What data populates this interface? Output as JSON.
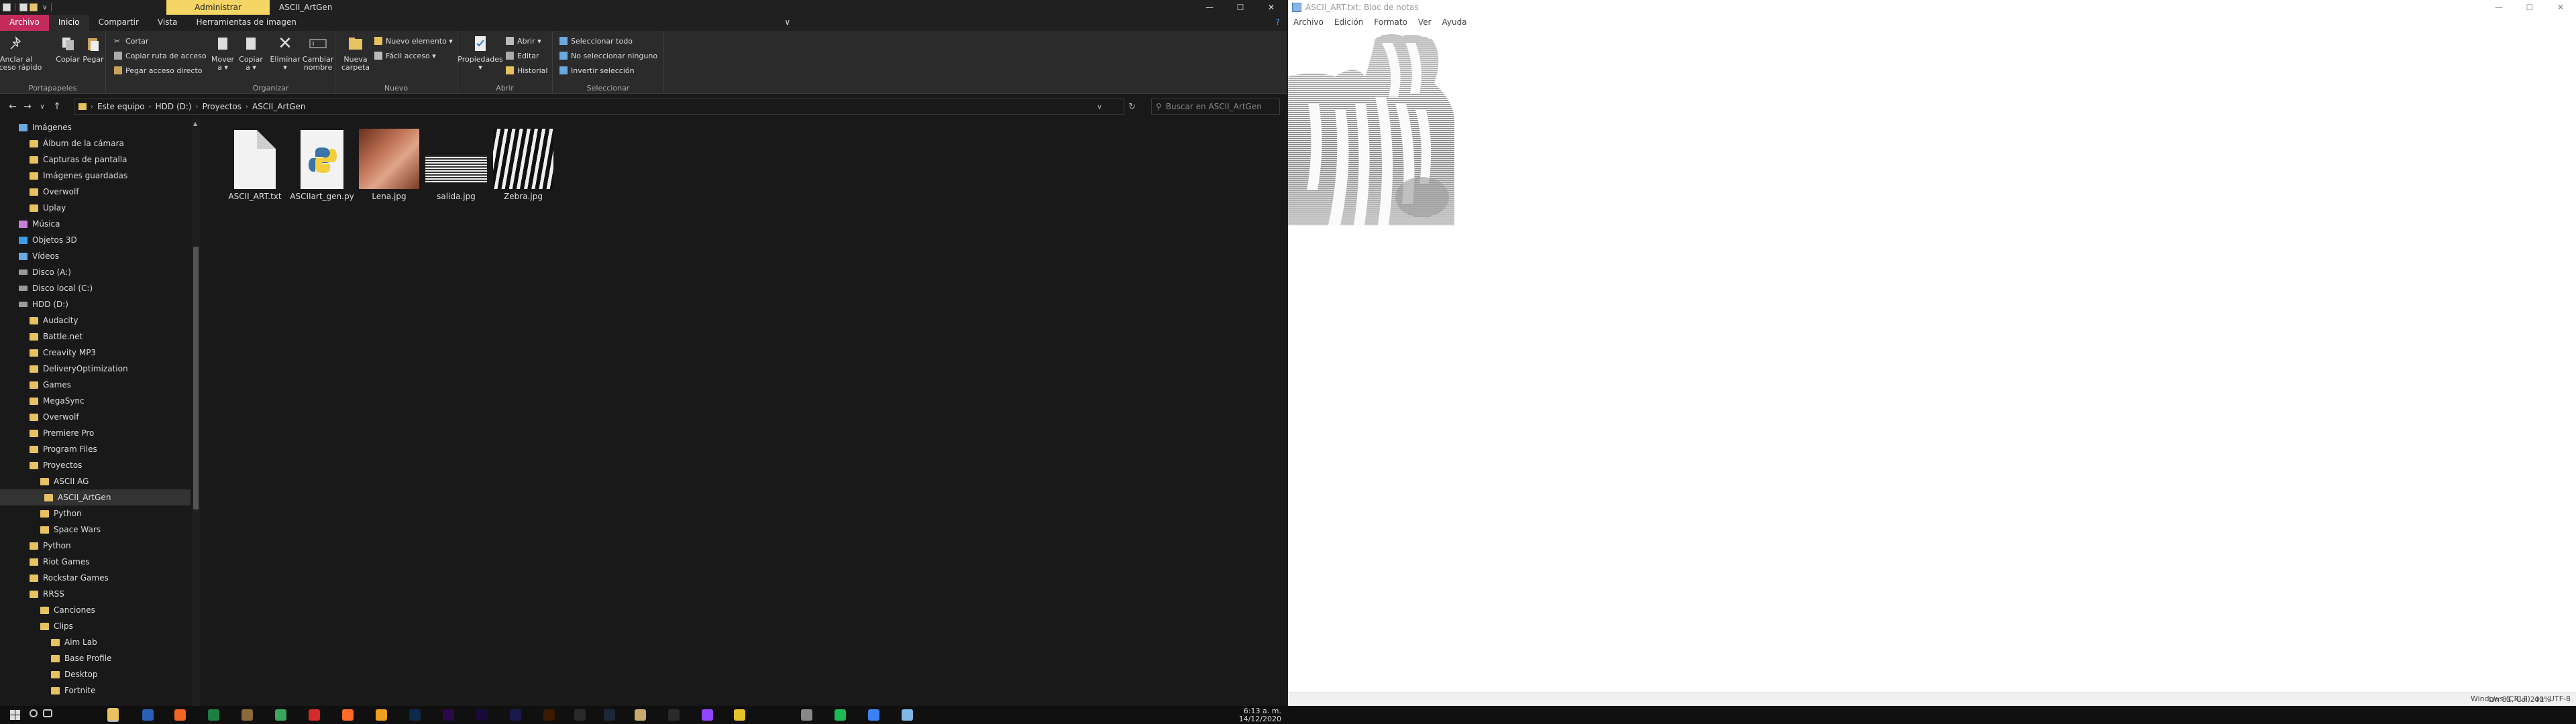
{
  "explorer": {
    "title": "ASCII_ArtGen",
    "context_tab": "Administrar",
    "window_controls": [
      "—",
      "☐",
      "✕"
    ],
    "ribbon_tabs": [
      {
        "label": "Archivo"
      },
      {
        "label": "Inicio"
      },
      {
        "label": "Compartir"
      },
      {
        "label": "Vista"
      },
      {
        "label": "Herramientas de imagen"
      }
    ],
    "ribbon": {
      "portapapeles": {
        "label": "Portapapeles",
        "anclar": "Anclar al\nacceso rápido",
        "copiar": "Copiar",
        "pegar": "Pegar",
        "cortar": "Cortar",
        "copiar_ruta": "Copiar ruta de acceso",
        "pegar_acceso": "Pegar acceso directo"
      },
      "organizar": {
        "label": "Organizar",
        "mover": "Mover\na ▾",
        "copiar": "Copiar\na ▾",
        "eliminar": "Eliminar\n▾",
        "cambiar": "Cambiar\nnombre"
      },
      "nuevo": {
        "label": "Nuevo",
        "nueva_carpeta": "Nueva\ncarpeta",
        "nuevo_elemento": "Nuevo elemento ▾",
        "facil_acceso": "Fácil acceso ▾"
      },
      "abrir": {
        "label": "Abrir",
        "propiedades": "Propiedades\n▾",
        "abrir": "Abrir ▾",
        "editar": "Editar",
        "historial": "Historial"
      },
      "seleccionar": {
        "label": "Seleccionar",
        "todo": "Seleccionar todo",
        "ninguno": "No seleccionar ninguno",
        "invertir": "Invertir selección"
      }
    },
    "breadcrumb": [
      "Este equipo",
      "HDD (D:)",
      "Proyectos",
      "ASCII_ArtGen"
    ],
    "search_placeholder": "Buscar en ASCII_ArtGen",
    "nav_items": [
      {
        "label": "Imágenes",
        "indent": 0
      },
      {
        "label": "Álbum de la cámara",
        "indent": 1
      },
      {
        "label": "Capturas de pantalla",
        "indent": 1
      },
      {
        "label": "Imágenes guardadas",
        "indent": 1
      },
      {
        "label": "Overwolf",
        "indent": 1
      },
      {
        "label": "Uplay",
        "indent": 1
      },
      {
        "label": "Música",
        "indent": 0
      },
      {
        "label": "Objetos 3D",
        "indent": 0
      },
      {
        "label": "Vídeos",
        "indent": 0
      },
      {
        "label": "Disco (A:)",
        "indent": 0
      },
      {
        "label": "Disco local (C:)",
        "indent": 0
      },
      {
        "label": "HDD (D:)",
        "indent": 0
      },
      {
        "label": "Audacity",
        "indent": 1
      },
      {
        "label": "Battle.net",
        "indent": 1
      },
      {
        "label": "Creavity MP3",
        "indent": 1
      },
      {
        "label": "DeliveryOptimization",
        "indent": 1
      },
      {
        "label": "Games",
        "indent": 1
      },
      {
        "label": "MegaSync",
        "indent": 1
      },
      {
        "label": "Overwolf",
        "indent": 1
      },
      {
        "label": "Premiere Pro",
        "indent": 1
      },
      {
        "label": "Program Files",
        "indent": 1
      },
      {
        "label": "Proyectos",
        "indent": 1
      },
      {
        "label": "ASCII AG",
        "indent": 2
      },
      {
        "label": "ASCII_ArtGen",
        "indent": 2
      },
      {
        "label": "Python",
        "indent": 2
      },
      {
        "label": "Space Wars",
        "indent": 2
      },
      {
        "label": "Python",
        "indent": 1
      },
      {
        "label": "Riot Games",
        "indent": 1
      },
      {
        "label": "Rockstar Games",
        "indent": 1
      },
      {
        "label": "RRSS",
        "indent": 1
      },
      {
        "label": "Canciones",
        "indent": 2
      },
      {
        "label": "Clips",
        "indent": 2
      },
      {
        "label": "Aim Lab",
        "indent": 3
      },
      {
        "label": "Base Profile",
        "indent": 3
      },
      {
        "label": "Desktop",
        "indent": 3
      },
      {
        "label": "Fortnite",
        "indent": 3
      }
    ],
    "files": [
      {
        "name": "ASCII_ART.txt",
        "kind": "txt"
      },
      {
        "name": "ASCIIart_gen.py",
        "kind": "py"
      },
      {
        "name": "Lena.jpg",
        "kind": "lena"
      },
      {
        "name": "salida.jpg",
        "kind": "salida"
      },
      {
        "name": "Zebra.jpg",
        "kind": "zebra"
      }
    ]
  },
  "notepad": {
    "title": "ASCII_ART.txt: Bloc de notas",
    "menu": [
      "Archivo",
      "Edición",
      "Formato",
      "Ver",
      "Ayuda"
    ],
    "status": {
      "position": "Lín 81, Col 201",
      "zoom": "40%",
      "eol": "Windows (CRLF)",
      "encoding": "UTF-8"
    }
  },
  "taskbar": {
    "time": "6:13 a. m.",
    "date": "14/12/2020",
    "apps": [
      {
        "name": "windows-start-icon",
        "color": "#4da3ff"
      },
      {
        "name": "search-icon",
        "color": "#cccccc"
      },
      {
        "name": "task-view-icon",
        "color": "#cccccc"
      },
      {
        "name": "file-explorer-icon",
        "color": "#e8c25f",
        "active": true
      },
      {
        "name": "word-icon",
        "color": "#2b5fb5"
      },
      {
        "name": "origin-icon",
        "color": "#f26522"
      },
      {
        "name": "excel-icon",
        "color": "#1e7f45"
      },
      {
        "name": "minecraft-icon",
        "color": "#8a6a3a"
      },
      {
        "name": "chrome-icon",
        "color": "#3ba55d"
      },
      {
        "name": "opera-icon",
        "color": "#d42a2a"
      },
      {
        "name": "brave-icon",
        "color": "#ff6a2b"
      },
      {
        "name": "audacity-icon",
        "color": "#f0a020"
      },
      {
        "name": "photoshop-icon",
        "color": "#0c2a4a"
      },
      {
        "name": "premiere-icon",
        "color": "#2a0a4a"
      },
      {
        "name": "after-effects-icon",
        "color": "#1a0a3a"
      },
      {
        "name": "adobe-media-encoder-icon",
        "color": "#1a1a4a"
      },
      {
        "name": "illustrator-icon",
        "color": "#3a1a00"
      },
      {
        "name": "epic-games-icon",
        "color": "#2a2a2a"
      },
      {
        "name": "steam-icon",
        "color": "#1b2838"
      },
      {
        "name": "league-icon",
        "color": "#c8aa6e"
      },
      {
        "name": "ubisoft-icon",
        "color": "#2a2a2a"
      },
      {
        "name": "twitch-icon",
        "color": "#9146ff"
      },
      {
        "name": "overwolf-icon",
        "color": "#e6c12a"
      },
      {
        "name": "settings-gear-icon",
        "color": "#888888"
      },
      {
        "name": "spotify-icon",
        "color": "#1db954"
      },
      {
        "name": "facebook-icon",
        "color": "#3b82f6"
      },
      {
        "name": "notepad-icon",
        "color": "#7fb7e8"
      }
    ]
  }
}
